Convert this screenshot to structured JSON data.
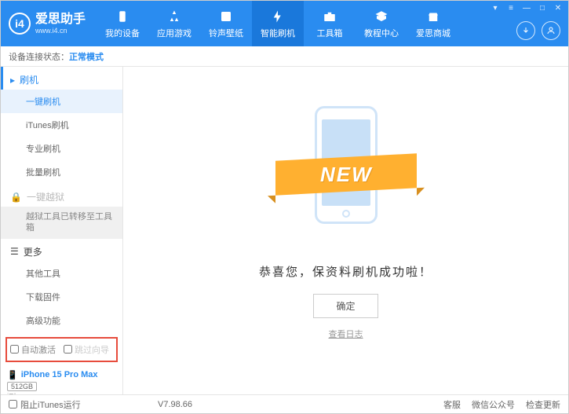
{
  "header": {
    "app_name": "爱思助手",
    "url": "www.i4.cn",
    "nav": [
      {
        "label": "我的设备"
      },
      {
        "label": "应用游戏"
      },
      {
        "label": "铃声壁纸"
      },
      {
        "label": "智能刷机"
      },
      {
        "label": "工具箱"
      },
      {
        "label": "教程中心"
      },
      {
        "label": "爱思商城"
      }
    ]
  },
  "status": {
    "label": "设备连接状态：",
    "mode": "正常模式"
  },
  "sidebar": {
    "flash_section": "刷机",
    "items_flash": [
      "一键刷机",
      "iTunes刷机",
      "专业刷机",
      "批量刷机"
    ],
    "jailbreak_section": "一键越狱",
    "jailbreak_moved": "越狱工具已转移至工具箱",
    "more_section": "更多",
    "items_more": [
      "其他工具",
      "下载固件",
      "高级功能"
    ],
    "auto_activate": "自动激活",
    "skip_guide": "跳过向导",
    "device_name": "iPhone 15 Pro Max",
    "storage": "512GB",
    "device_type": "iPhone"
  },
  "main": {
    "banner": "NEW",
    "success_text": "恭喜您，保资料刷机成功啦！",
    "ok_button": "确定",
    "view_log": "查看日志"
  },
  "footer": {
    "block_itunes": "阻止iTunes运行",
    "version": "V7.98.66",
    "links": [
      "客服",
      "微信公众号",
      "检查更新"
    ]
  }
}
